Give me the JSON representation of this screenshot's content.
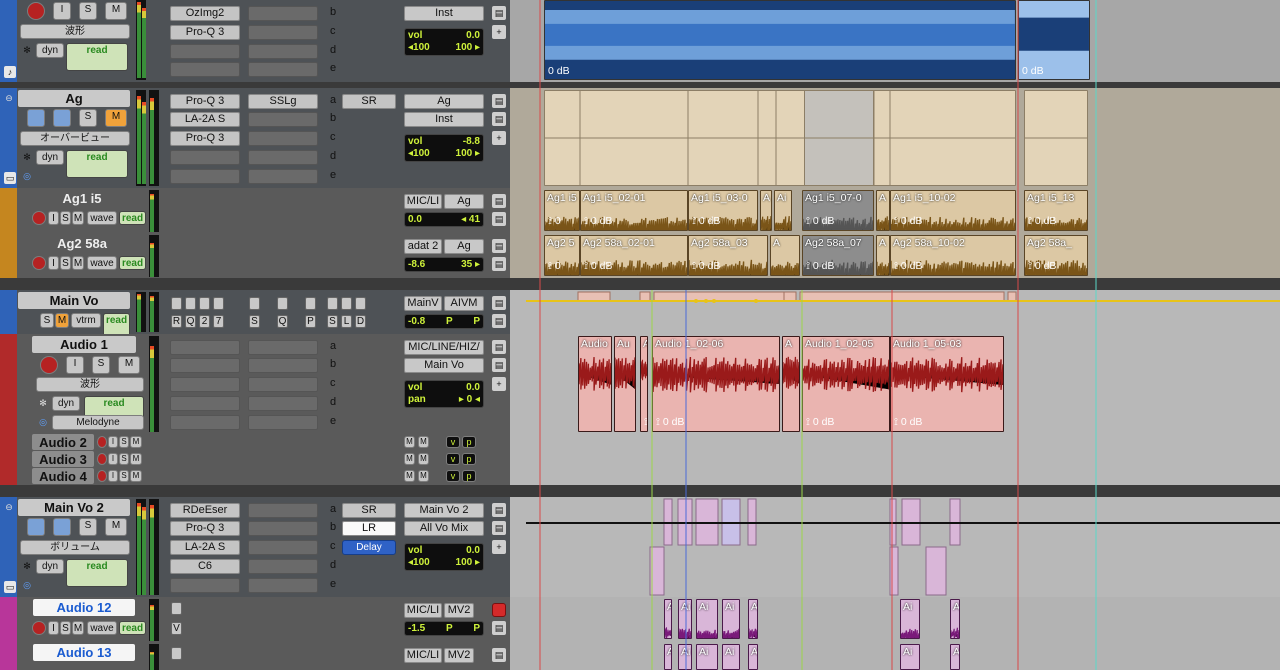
{
  "tracks": {
    "top": {
      "color": "#2f63b8",
      "btn_s": "S",
      "btn_m": "M",
      "btn_i": "I",
      "mode": "波形",
      "dyn": "dyn",
      "read": "read",
      "inserts": [
        "OzImg2",
        "Pro-Q 3"
      ],
      "send_letters": [
        "b",
        "c",
        "d",
        "e"
      ],
      "io_out": "Inst",
      "vol_label": "vol",
      "vol": "0.0",
      "pan_l": "◂100",
      "pan_r": "100 ▸",
      "clip_db": "0 dB"
    },
    "ag": {
      "name": "Ag",
      "color": "#2f63b8",
      "btn_s": "S",
      "btn_m": "M",
      "mode": "オーバービュー",
      "dyn": "dyn",
      "read": "read",
      "inserts": [
        "Pro-Q 3",
        "LA-2A S",
        "Pro-Q 3"
      ],
      "send_a": "SSLg",
      "send_letters": [
        "a",
        "b",
        "c",
        "d",
        "e"
      ],
      "send_sr": "SR",
      "io_in": "Ag",
      "io_out": "Inst",
      "vol_label": "vol",
      "vol": "-8.8",
      "pan_l": "◂100",
      "pan_r": "100 ▸"
    },
    "ag1": {
      "name": "Ag1 i5",
      "color": "#c5861f",
      "io_in": "MIC/LI",
      "io_out": "Ag",
      "vol": "0.0",
      "pan": "◂ 41",
      "i": "I",
      "s": "S",
      "m": "M",
      "wave": "wave",
      "read": "read",
      "clips": [
        {
          "name": "Ag1 i5",
          "db": "0"
        },
        {
          "name": "Ag1 i5_02-01",
          "db": "0 dB"
        },
        {
          "name": "Ag1 i5_03-0",
          "db": "0 dB"
        },
        {
          "name": "A",
          "db": ""
        },
        {
          "name": "Ai",
          "db": ""
        },
        {
          "name": "Ag1 i5_07-0",
          "db": "0 dB"
        },
        {
          "name": "A",
          "db": ""
        },
        {
          "name": "Ag1 i5_10-02",
          "db": "0 dB"
        },
        {
          "name": "Ag1 i5_13",
          "db": "0 dB"
        }
      ]
    },
    "ag2": {
      "name": "Ag2 58a",
      "color": "#c5861f",
      "io_in": "adat 2",
      "io_out": "Ag",
      "vol": "-8.6",
      "pan": "35 ▸",
      "i": "I",
      "s": "S",
      "m": "M",
      "wave": "wave",
      "read": "read",
      "clips": [
        {
          "name": "Ag2 5",
          "db": "0"
        },
        {
          "name": "Ag2 58a_02-01",
          "db": "0 dB"
        },
        {
          "name": "Ag2 58a_03",
          "db": "0 dB"
        },
        {
          "name": "A",
          "db": ""
        },
        {
          "name": "Ag2 58a_07",
          "db": "0 dB"
        },
        {
          "name": "A",
          "db": ""
        },
        {
          "name": "Ag2 58a_10-02",
          "db": "0 dB"
        },
        {
          "name": "Ag2 58a_",
          "db": "0 dB"
        }
      ]
    },
    "mainvo": {
      "name": "Main Vo",
      "color": "#2f63b8",
      "io_in": "MainV",
      "io_out": "AIVM",
      "vol": "-0.8",
      "p1": "P",
      "p2": "P",
      "btn_s": "S",
      "btn_m": "M",
      "vtrm": "vtrm",
      "read": "read",
      "row1": [
        "R",
        "Q",
        "2",
        "7"
      ],
      "row2": [
        "S",
        "Q",
        "P"
      ],
      "row3": [
        "S",
        "L",
        "D"
      ]
    },
    "audio1": {
      "name": "Audio 1",
      "color": "#b12a2a",
      "btn_i": "I",
      "btn_s": "S",
      "btn_m": "M",
      "mode": "波形",
      "dyn": "dyn",
      "read": "read",
      "plugin": "Melodyne",
      "send_letters": [
        "a",
        "b",
        "c",
        "d",
        "e"
      ],
      "io_in": "MIC/LINE/HIZ/",
      "io_out": "Main Vo",
      "vol_label": "vol",
      "vol": "0.0",
      "pan_label": "pan",
      "pan": "▸ 0 ◂",
      "clips": [
        {
          "name": "Audio",
          "db": ""
        },
        {
          "name": "Au",
          "db": ""
        },
        {
          "name": "Audio",
          "db": "0 dl"
        },
        {
          "name": "Audio 1_02-06",
          "db": "0 dB"
        },
        {
          "name": "A",
          "db": ""
        },
        {
          "name": "Audio 1_02-05",
          "db": "0 dB"
        },
        {
          "name": "Audio 1_05-03",
          "db": "0 dB"
        }
      ]
    },
    "audio2": {
      "name": "Audio 2",
      "i": "I",
      "s": "S",
      "m": "M",
      "mm": "M",
      "v": "v",
      "p": "p"
    },
    "audio3": {
      "name": "Audio 3",
      "i": "I",
      "s": "S",
      "m": "M",
      "mm": "M",
      "v": "v",
      "p": "p"
    },
    "audio4": {
      "name": "Audio 4",
      "i": "I",
      "s": "S",
      "m": "M",
      "mm": "M",
      "v": "v",
      "p": "p"
    },
    "mainvo2": {
      "name": "Main Vo 2",
      "color": "#2f63b8",
      "btn_s": "S",
      "btn_m": "M",
      "mode": "ボリューム",
      "dyn": "dyn",
      "read": "read",
      "inserts": [
        "RDeEser",
        "Pro-Q 3",
        "LA-2A S",
        "C6"
      ],
      "send_letters": [
        "a",
        "b",
        "c",
        "d",
        "e"
      ],
      "send_sr": "SR",
      "send_lr": "LR",
      "send_delay": "Delay",
      "io_in": "Main Vo 2",
      "io_out": "All Vo Mix",
      "vol_label": "vol",
      "vol": "0.0",
      "pan_l": "◂100",
      "pan_r": "100 ▸"
    },
    "audio12": {
      "name": "Audio 12",
      "color": "#b8369a",
      "io_in": "MIC/LI",
      "io_out": "MV2",
      "vol": "-1.5",
      "p1": "P",
      "p2": "P",
      "i": "I",
      "s": "S",
      "m": "M",
      "wave": "wave",
      "read": "read",
      "v": "V",
      "clips": [
        "A",
        "Ai",
        "Ai",
        "Ai"
      ]
    },
    "audio13": {
      "name": "Audio 13",
      "color": "#b8369a",
      "io_in": "MIC/LI",
      "io_out": "MV2",
      "clips": [
        "A",
        "Ai",
        "Ai",
        "Ai"
      ]
    }
  }
}
